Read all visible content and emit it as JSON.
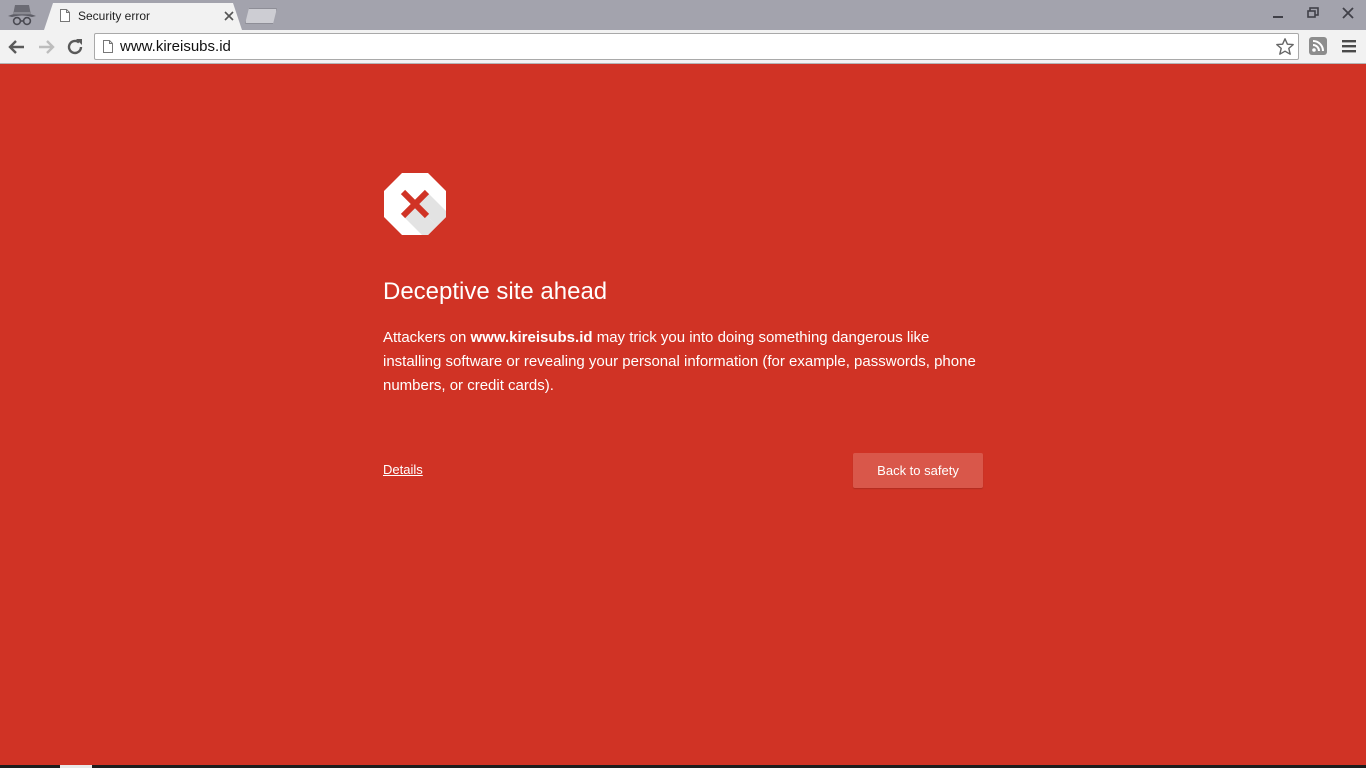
{
  "browser": {
    "tab": {
      "title": "Security error"
    },
    "address_bar": {
      "url": "www.kireisubs.id"
    }
  },
  "interstitial": {
    "heading": "Deceptive site ahead",
    "body_prefix": "Attackers on ",
    "body_domain": "www.kireisubs.id",
    "body_suffix": " may trick you into doing something dangerous like installing software or revealing your personal information (for example, passwords, phone numbers, or credit cards).",
    "details_label": "Details",
    "back_button_label": "Back to safety"
  },
  "icons": {
    "incognito": "incognito-icon",
    "tab_favicon": "page-icon",
    "tab_close": "close-icon",
    "minimize": "minimize-icon",
    "restore": "restore-icon",
    "close_window": "close-icon",
    "back": "arrow-left-icon",
    "forward": "arrow-right-icon",
    "reload": "reload-icon",
    "bookmark": "star-icon",
    "extension": "rss-icon",
    "menu": "hamburger-menu-icon",
    "warning": "stop-sign-x-icon"
  },
  "colors": {
    "page_background": "#d03325",
    "button_background": "#d9574a",
    "tabstrip": "#a3a3ad",
    "toolbar": "#f2f2f2",
    "text": "#ffffff"
  }
}
